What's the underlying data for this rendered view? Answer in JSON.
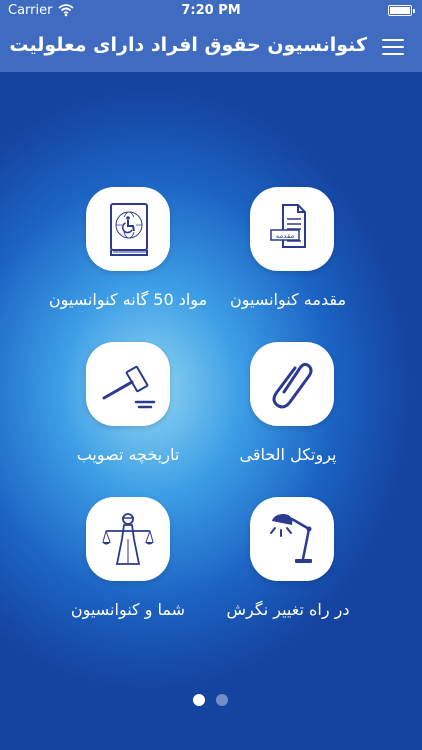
{
  "status_bar": {
    "carrier": "Carrier",
    "time": "7:20 PM"
  },
  "nav": {
    "title": "کنوانسیون حقوق افراد دارای معلولیت"
  },
  "tiles": [
    {
      "label": "مقدمه کنوانسیون",
      "icon": "document-icon",
      "icon_text": "مقدمه"
    },
    {
      "label": "مواد 50 گانه کنوانسیون",
      "icon": "book-icon"
    },
    {
      "label": "پروتکل الحاقی",
      "icon": "paperclip-icon"
    },
    {
      "label": "تاریخچه تصویب",
      "icon": "gavel-icon"
    },
    {
      "label": "در راه تغییر نگرش",
      "icon": "lamp-icon"
    },
    {
      "label": "شما و کنوانسیون",
      "icon": "justice-icon"
    }
  ],
  "pagination": {
    "pages": 2,
    "current": 1
  },
  "colors": {
    "nav": "#3f6cc0",
    "icon_stroke": "#2c3a8f"
  }
}
